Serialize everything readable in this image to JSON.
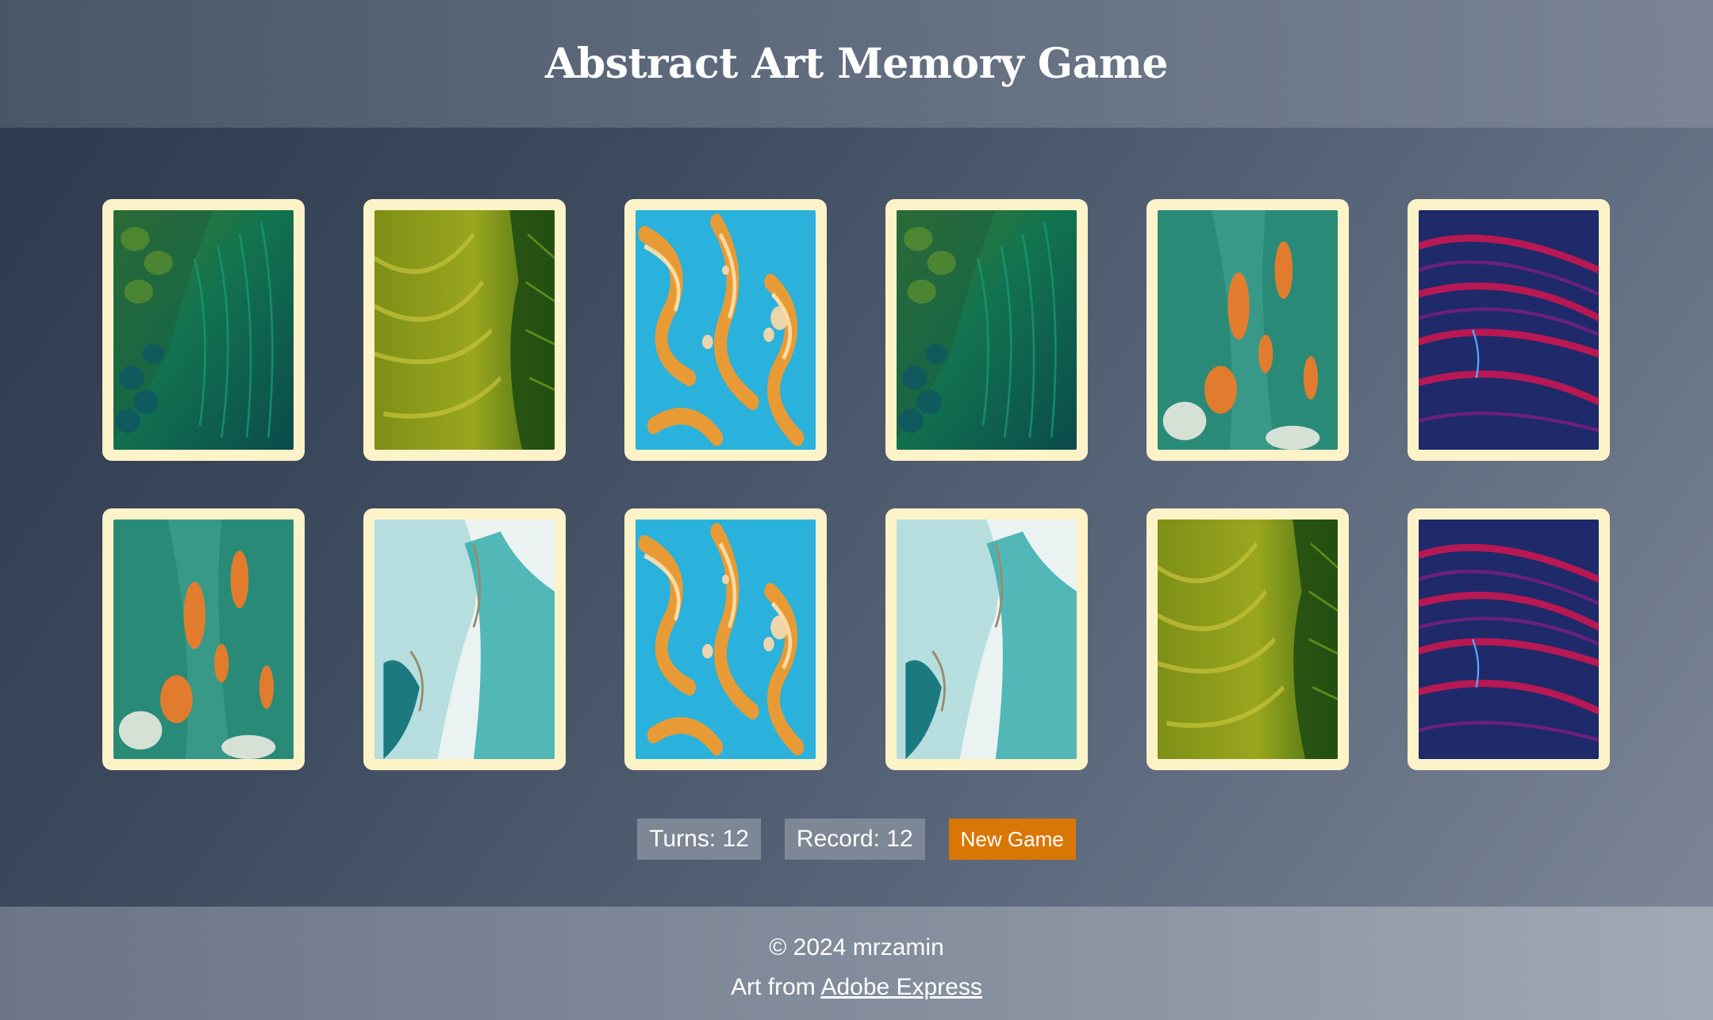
{
  "header": {
    "title": "Abstract Art Memory Game"
  },
  "cards": [
    {
      "art": "peacock-feathers"
    },
    {
      "art": "green-terraces"
    },
    {
      "art": "orange-blue-marble"
    },
    {
      "art": "peacock-feathers"
    },
    {
      "art": "teal-orange-splash"
    },
    {
      "art": "red-blue-fur"
    },
    {
      "art": "teal-orange-splash"
    },
    {
      "art": "turquoise-coast"
    },
    {
      "art": "orange-blue-marble"
    },
    {
      "art": "turquoise-coast"
    },
    {
      "art": "green-terraces"
    },
    {
      "art": "red-blue-fur"
    }
  ],
  "stats": {
    "turns": "Turns: 12",
    "record": "Record: 12"
  },
  "buttons": {
    "new_game": "New Game"
  },
  "footer": {
    "copyright": "© 2024 mrzamin",
    "art_prefix": "Art from ",
    "art_link": "Adobe Express"
  },
  "colors": {
    "card_border": "#fdf3c8",
    "accent": "#d97706",
    "stat_bg": "#7d8796"
  }
}
